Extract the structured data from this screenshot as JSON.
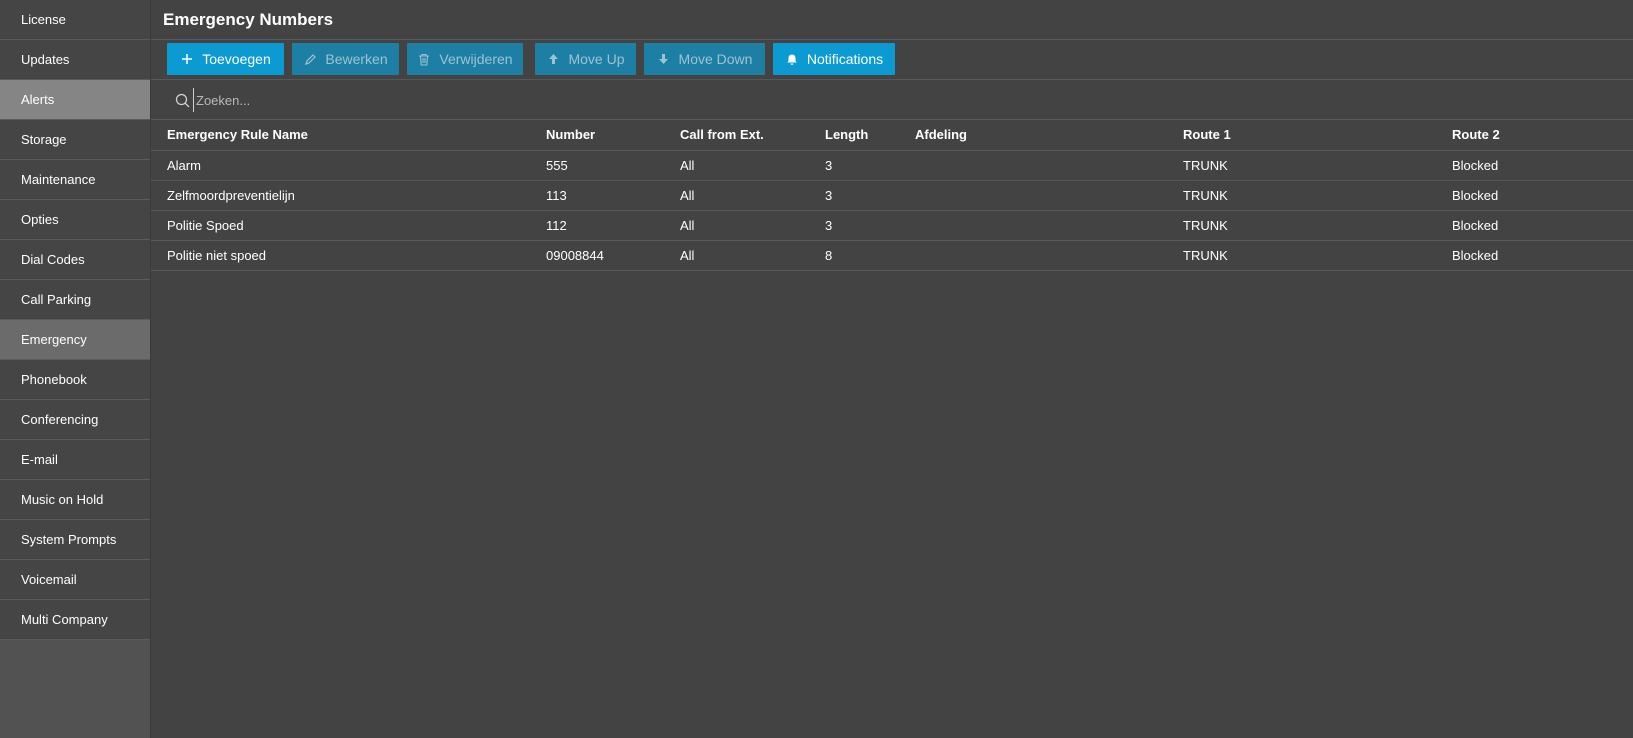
{
  "sidebar": {
    "items": [
      {
        "label": "License"
      },
      {
        "label": "Updates"
      },
      {
        "label": "Alerts"
      },
      {
        "label": "Storage"
      },
      {
        "label": "Maintenance"
      },
      {
        "label": "Opties"
      },
      {
        "label": "Dial Codes"
      },
      {
        "label": "Call Parking"
      },
      {
        "label": "Emergency"
      },
      {
        "label": "Phonebook"
      },
      {
        "label": "Conferencing"
      },
      {
        "label": "E-mail"
      },
      {
        "label": "Music on Hold"
      },
      {
        "label": "System Prompts"
      },
      {
        "label": "Voicemail"
      },
      {
        "label": "Multi Company"
      }
    ],
    "selected": "Emergency"
  },
  "page": {
    "title": "Emergency Numbers"
  },
  "toolbar": {
    "add_label": "Toevoegen",
    "edit_label": "Bewerken",
    "delete_label": "Verwijderen",
    "move_up_label": "Move Up",
    "move_down_label": "Move Down",
    "notifications_label": "Notifications"
  },
  "search": {
    "placeholder": "Zoeken...",
    "value": ""
  },
  "table": {
    "columns": [
      "Emergency Rule Name",
      "Number",
      "Call from Ext.",
      "Length",
      "Afdeling",
      "Route 1",
      "Route 2"
    ],
    "rows": [
      {
        "name": "Alarm",
        "number": "555",
        "call_from": "All",
        "length": "3",
        "afdeling": "",
        "route1": "TRUNK",
        "route2": "Blocked"
      },
      {
        "name": "Zelfmoordpreventielijn",
        "number": "113",
        "call_from": "All",
        "length": "3",
        "afdeling": "",
        "route1": "TRUNK",
        "route2": "Blocked"
      },
      {
        "name": "Politie Spoed",
        "number": "112",
        "call_from": "All",
        "length": "3",
        "afdeling": "",
        "route1": "TRUNK",
        "route2": "Blocked"
      },
      {
        "name": "Politie niet spoed",
        "number": "09008844",
        "call_from": "All",
        "length": "8",
        "afdeling": "",
        "route1": "TRUNK",
        "route2": "Blocked"
      }
    ]
  },
  "colors": {
    "accent": "#0c9ad3",
    "accent_disabled": "#1d7fa3",
    "background": "#434343",
    "sidebar_selected": "#6b6b6b"
  },
  "icons": {
    "add": "plus-icon",
    "edit": "pencil-icon",
    "delete": "trash-icon",
    "move_up": "arrow-up-icon",
    "move_down": "arrow-down-icon",
    "notifications": "bell-icon",
    "search": "search-icon"
  }
}
